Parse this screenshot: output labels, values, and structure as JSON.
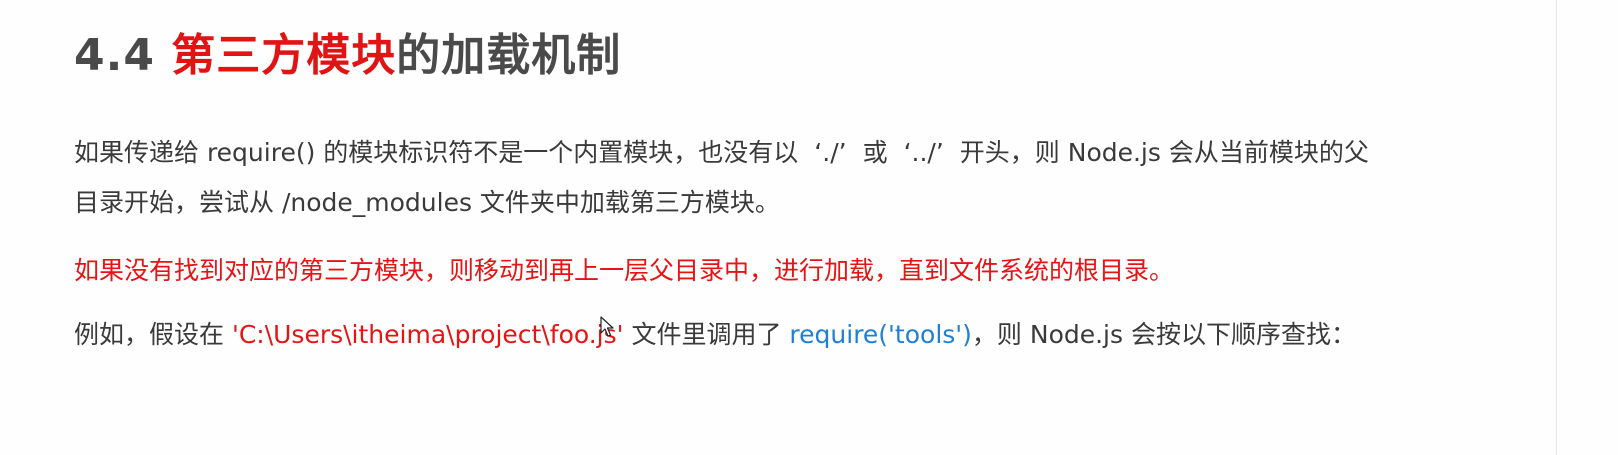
{
  "slide": {
    "title_number": "4.4",
    "title_highlight": "第三方模块",
    "title_rest": "的加载机制",
    "paragraph1": {
      "line1_a": "如果传递给 require() 的模块标识符不是一个内置模块，也没有以",
      "line1_q1": "‘./’",
      "line1_b": "或",
      "line1_q2": "‘../’",
      "line1_c": "开头，则 Node.js 会从当前模块的父",
      "line2": "目录开始，尝试从 /node_modules 文件夹中加载第三方模块。"
    },
    "paragraph2": "如果没有找到对应的第三方模块，则移动到再上一层父目录中，进行加载，直到文件系统的根目录。",
    "paragraph3": {
      "prefix": "例如，假设在 ",
      "path": "'C:\\Users\\itheima\\project\\foo.js'",
      "middle": " 文件里调用了 ",
      "code": "require('tools')",
      "suffix": "，则 Node.js 会按以下顺序查找："
    }
  },
  "colors": {
    "accent_red": "#e01414",
    "link_blue": "#1f7fd6",
    "text_gray": "#3a3a3a"
  }
}
